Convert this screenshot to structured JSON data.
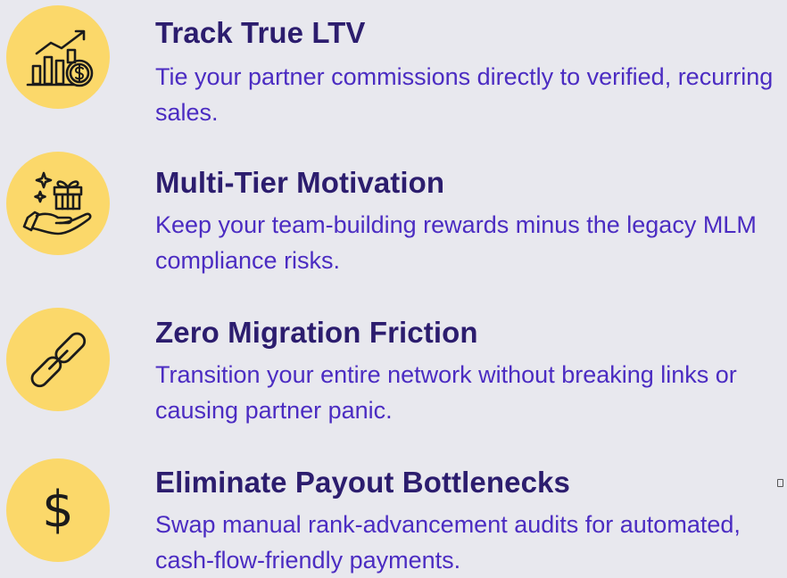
{
  "features": [
    {
      "icon": "growth-chart-coin-icon",
      "title": "Track True LTV",
      "description": "Tie your partner commissions directly to verified, recurring sales."
    },
    {
      "icon": "gift-hand-icon",
      "title": "Multi-Tier Motivation",
      "description": "Keep your team-building rewards minus the legacy MLM compliance risks."
    },
    {
      "icon": "link-icon",
      "title": "Zero Migration Friction",
      "description": "Transition your entire network without breaking links or causing partner panic."
    },
    {
      "icon": "dollar-icon",
      "icon_glyph": "$",
      "title": "Eliminate Payout Bottlenecks",
      "description": "Swap manual rank-advancement audits for automated, cash-flow-friendly payments."
    }
  ],
  "colors": {
    "background": "#e8e8ee",
    "icon_circle": "#fbd86a",
    "title": "#2c1d6e",
    "description": "#4b2cc2"
  }
}
